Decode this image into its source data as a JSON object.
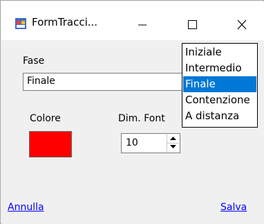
{
  "window": {
    "title": "FormTracci..."
  },
  "form": {
    "fase_label": "Fase",
    "fase_value": "Finale",
    "colore_label": "Colore",
    "color": "#ff0000",
    "font_label": "Dim. Font",
    "font_value": "10"
  },
  "links": {
    "cancel": "Annulla",
    "save": "Salva"
  },
  "dropdown": {
    "items": [
      {
        "label": "Iniziale",
        "selected": false
      },
      {
        "label": "Intermedio",
        "selected": false
      },
      {
        "label": "Finale",
        "selected": true
      },
      {
        "label": "Contenzione",
        "selected": false
      },
      {
        "label": "A distanza",
        "selected": false
      }
    ]
  },
  "colors": {
    "accent": "#0078d7",
    "link": "#0000ff"
  }
}
